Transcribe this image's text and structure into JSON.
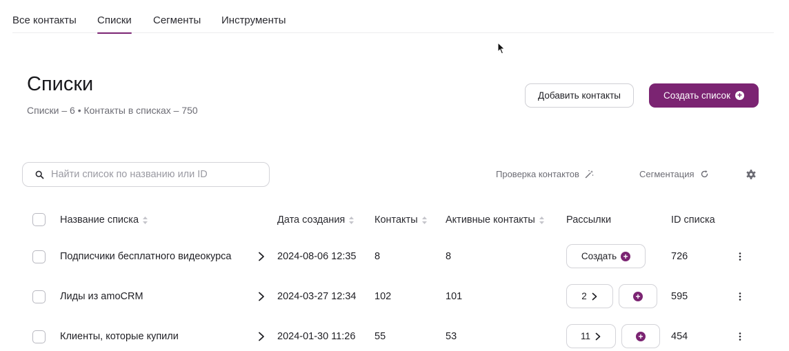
{
  "tabs": [
    {
      "label": "Все контакты",
      "active": false
    },
    {
      "label": "Списки",
      "active": true
    },
    {
      "label": "Сегменты",
      "active": false
    },
    {
      "label": "Инструменты",
      "active": false
    }
  ],
  "header": {
    "title": "Списки",
    "subtitle": "Списки – 6 • Контакты в списках – 750",
    "add_contacts_label": "Добавить контакты",
    "create_list_label": "Создать список"
  },
  "toolbar": {
    "search_placeholder": "Найти список по названию или ID",
    "check_contacts_label": "Проверка контактов",
    "segmentation_label": "Сегментация"
  },
  "table": {
    "columns": {
      "name": "Название списка",
      "created": "Дата создания",
      "contacts": "Контакты",
      "active": "Активные контакты",
      "mailings": "Рассылки",
      "id": "ID списка"
    },
    "rows": [
      {
        "name": "Подписчики бесплатного видеокурса",
        "created": "2024-08-06 12:35",
        "contacts": "8",
        "active": "8",
        "mailings_label": "Создать",
        "id": "726"
      },
      {
        "name": "Лиды из amoCRM",
        "created": "2024-03-27 12:34",
        "contacts": "102",
        "active": "101",
        "mailings_count": "2",
        "id": "595"
      },
      {
        "name": "Клиенты, которые купили",
        "created": "2024-01-30 11:26",
        "contacts": "55",
        "active": "53",
        "mailings_count": "11",
        "id": "454"
      }
    ]
  },
  "colors": {
    "accent": "#7b2472",
    "text": "#1f1f24",
    "muted": "#6c6c74",
    "border": "#d3d3d8"
  }
}
